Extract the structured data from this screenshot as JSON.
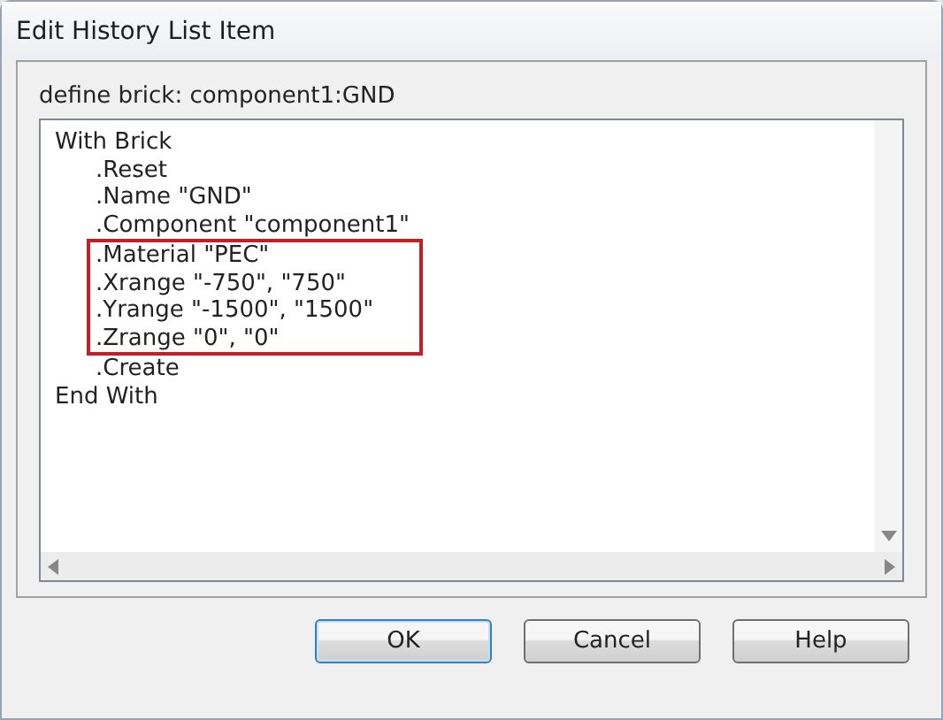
{
  "window": {
    "title": "Edit History List Item"
  },
  "group": {
    "label": "define brick: component1:GND"
  },
  "code": [
    {
      "text": "With Brick",
      "children": [
        {
          "text": ".Reset",
          "highlighted": false
        },
        {
          "text": ".Name \"GND\"",
          "highlighted": false
        },
        {
          "text": ".Component \"component1\"",
          "highlighted": false
        },
        {
          "text": ".Material \"PEC\"",
          "highlighted": true
        },
        {
          "text": ".Xrange \"-750\", \"750\"",
          "highlighted": true
        },
        {
          "text": ".Yrange \"-1500\", \"1500\"",
          "highlighted": true
        },
        {
          "text": ".Zrange \"0\", \"0\"",
          "highlighted": true
        },
        {
          "text": ".Create",
          "highlighted": false
        }
      ]
    },
    {
      "text": "End With"
    }
  ],
  "buttons": [
    {
      "label": "OK",
      "default": true
    },
    {
      "label": "Cancel",
      "default": false
    },
    {
      "label": "Help",
      "default": false
    }
  ]
}
